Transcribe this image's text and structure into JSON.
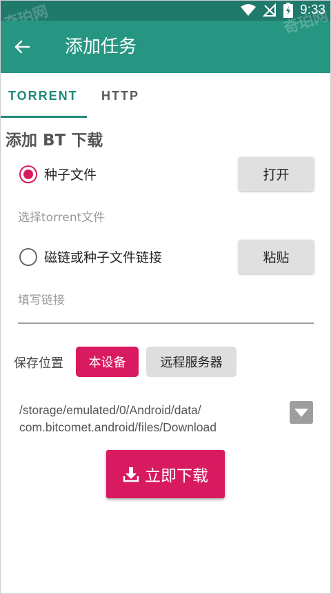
{
  "status_bar": {
    "time": "9:33",
    "icons": [
      "wifi-icon",
      "no-signal-icon",
      "battery-charging-icon"
    ]
  },
  "app_bar": {
    "title": "添加任务",
    "background": "#269682",
    "back_icon": "arrow-left-icon"
  },
  "tabs": [
    {
      "label": "TORRENT",
      "active": true
    },
    {
      "label": "HTTP",
      "active": false
    }
  ],
  "section_title": "添加 BT 下载",
  "torrent_option": {
    "label": "种子文件",
    "selected": true,
    "button_label": "打开",
    "hint": "选择torrent文件"
  },
  "link_option": {
    "label": "磁链或种子文件链接",
    "selected": false,
    "button_label": "粘贴",
    "input_placeholder": "填写链接"
  },
  "save_location": {
    "label": "保存位置",
    "options": [
      "本设备",
      "远程服务器"
    ],
    "selected": "本设备",
    "path_line1": "/storage/emulated/0/Android/data/",
    "path_line2": "com.bitcomet.android/files/Download"
  },
  "download_button": {
    "label": "立即下载",
    "icon": "download-icon",
    "color": "#d81b60"
  },
  "watermark": "奇珀网"
}
